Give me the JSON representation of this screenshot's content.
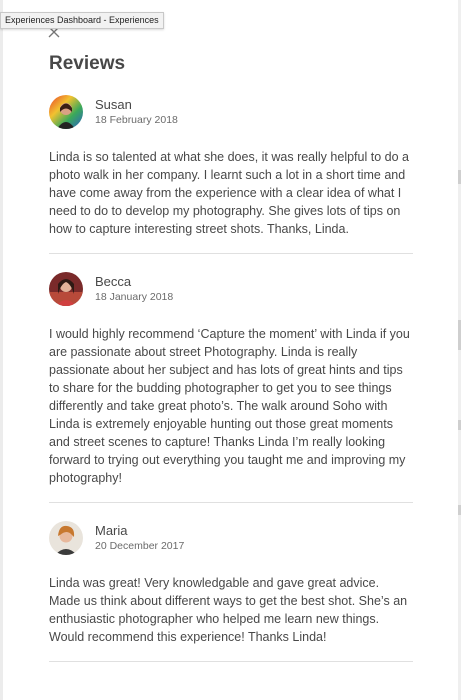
{
  "tooltip": "Experiences Dashboard - Experiences",
  "heading": "Reviews",
  "reviews": [
    {
      "name": "Susan",
      "date": "18 February 2018",
      "text": "Linda is so talented at what she does, it was really helpful to do a photo walk in her company. I learnt such a lot in a short time and have come away from the experience with a clear idea of what I need to do to develop my photography. She gives lots of tips on how to capture interesting street shots. Thanks, Linda."
    },
    {
      "name": "Becca",
      "date": "18 January 2018",
      "text": "I would highly recommend ‘Capture the moment’ with Linda if you are passionate about street Photography. Linda is really passionate about her subject and has lots of great hints and tips to share for the budding photographer to get you to see things differently and take great photo’s. The walk around Soho with Linda is extremely enjoyable hunting out those great moments and street scenes to capture! Thanks Linda I’m really looking forward to trying out everything you taught me and improving my photography!"
    },
    {
      "name": "Maria",
      "date": "20 December 2017",
      "text": "Linda was great! Very knowledgable and gave great advice. Made us think about different ways to get the best shot. She’s an enthusiastic photographer who helped me learn new things. Would recommend this experience! Thanks Linda!"
    }
  ],
  "icons": {
    "close": "close-icon"
  }
}
